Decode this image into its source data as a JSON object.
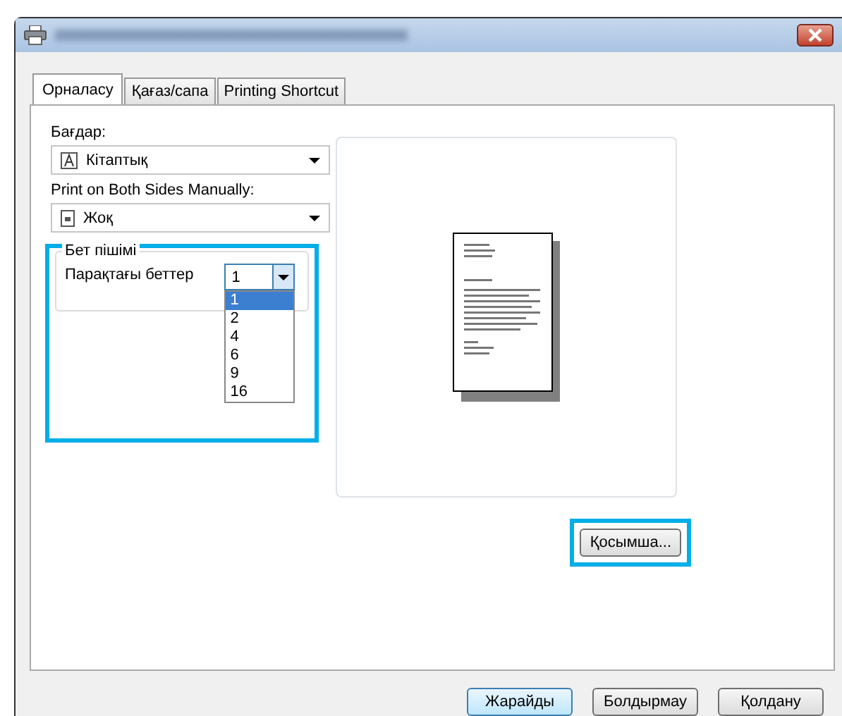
{
  "tabs": [
    {
      "label": "Орналасу",
      "selected": true
    },
    {
      "label": "Қағаз/сапа",
      "selected": false
    },
    {
      "label": "Printing Shortcut",
      "selected": false
    }
  ],
  "orientation": {
    "label": "Бағдар:",
    "value": "Кітаптық"
  },
  "duplex": {
    "label": "Print on Both Sides Manually:",
    "value": "Жоқ"
  },
  "page_layout": {
    "legend": "Бет пішімі",
    "label": "Парақтағы беттер",
    "value": "1",
    "expanded": true,
    "options": [
      {
        "label": "1",
        "selected": true
      },
      {
        "label": "2",
        "selected": false
      },
      {
        "label": "4",
        "selected": false
      },
      {
        "label": "6",
        "selected": false
      },
      {
        "label": "9",
        "selected": false
      },
      {
        "label": "16",
        "selected": false
      }
    ]
  },
  "advanced_button": "Қосымша...",
  "buttons": [
    {
      "label": "Жарайды",
      "default": true
    },
    {
      "label": "Болдырмау",
      "default": false
    },
    {
      "label": "Қолдану",
      "default": false
    }
  ]
}
